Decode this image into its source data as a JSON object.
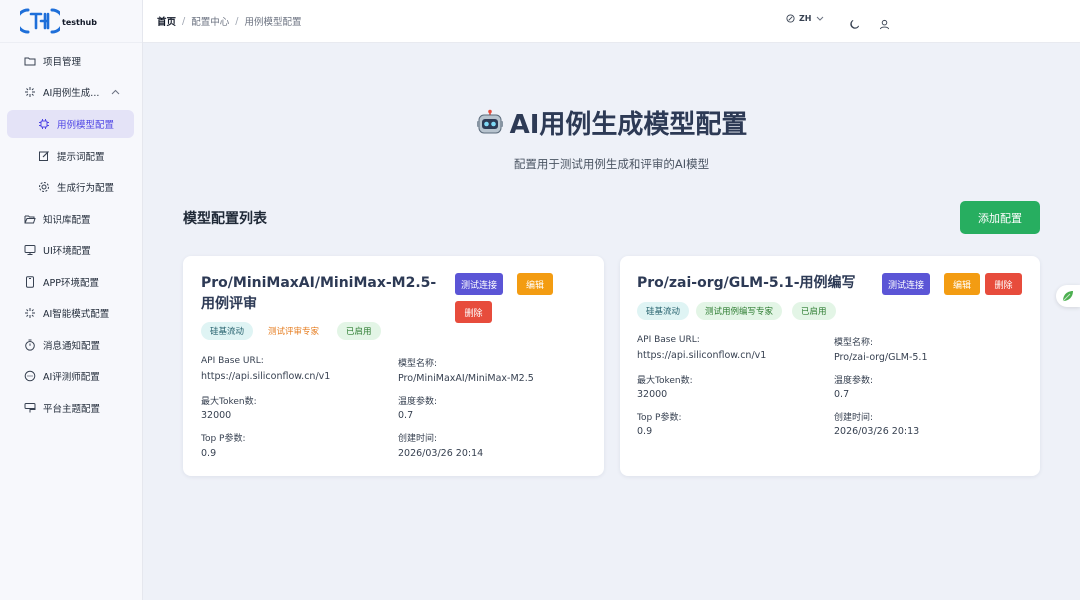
{
  "brand": {
    "name": "testhub",
    "mark": "TH"
  },
  "sidebar": {
    "items": [
      {
        "label": "项目管理",
        "icon": "folder-icon"
      },
      {
        "label": "AI用例生成...",
        "icon": "sparkle-icon"
      },
      {
        "label": "用例模型配置",
        "icon": "chip-icon"
      },
      {
        "label": "提示词配置",
        "icon": "edit-icon"
      },
      {
        "label": "生成行为配置",
        "icon": "gear-icon"
      },
      {
        "label": "知识库配置",
        "icon": "folder-open-icon"
      },
      {
        "label": "UI环境配置",
        "icon": "monitor-icon"
      },
      {
        "label": "APP环境配置",
        "icon": "phone-icon"
      },
      {
        "label": "AI智能模式配置",
        "icon": "sparkle-icon"
      },
      {
        "label": "消息通知配置",
        "icon": "timer-icon"
      },
      {
        "label": "AI评测师配置",
        "icon": "chat-icon"
      },
      {
        "label": "平台主题配置",
        "icon": "palette-icon"
      }
    ]
  },
  "header": {
    "breadcrumb": [
      "首页",
      "配置中心",
      "用例模型配置"
    ],
    "lang": "ZH"
  },
  "page": {
    "title": "AI用例生成模型配置",
    "subtitle": "配置用于测试用例生成和评审的AI模型",
    "section_title": "模型配置列表",
    "add_button": "添加配置"
  },
  "labels": {
    "test": "测试连接",
    "edit": "编辑",
    "delete": "删除",
    "api_base_url": "API Base URL:",
    "model_name": "模型名称:",
    "max_token": "最大Token数:",
    "temperature": "温度参数:",
    "top_p": "Top P参数:",
    "created": "创建时间:"
  },
  "cards": [
    {
      "name": "Pro/MiniMaxAI/MiniMax-M2.5-用例评审",
      "tags": [
        "硅基流动",
        "测试评审专家",
        "已启用"
      ],
      "api_base_url": "https://api.siliconflow.cn/v1",
      "model_name": "Pro/MiniMaxAI/MiniMax-M2.5",
      "max_token": "32000",
      "temperature": "0.7",
      "top_p": "0.9",
      "created": "2026/03/26 20:14"
    },
    {
      "name": "Pro/zai-org/GLM-5.1-用例编写",
      "tags": [
        "硅基流动",
        "测试用例编写专家",
        "已启用"
      ],
      "api_base_url": "https://api.siliconflow.cn/v1",
      "model_name": "Pro/zai-org/GLM-5.1",
      "max_token": "32000",
      "temperature": "0.7",
      "top_p": "0.9",
      "created": "2026/03/26 20:13"
    }
  ],
  "colors": {
    "primary": "#5b55d6",
    "success": "#27ae60",
    "warning": "#f39c12",
    "danger": "#e74c3c",
    "active_bg": "#e4e3f7"
  }
}
